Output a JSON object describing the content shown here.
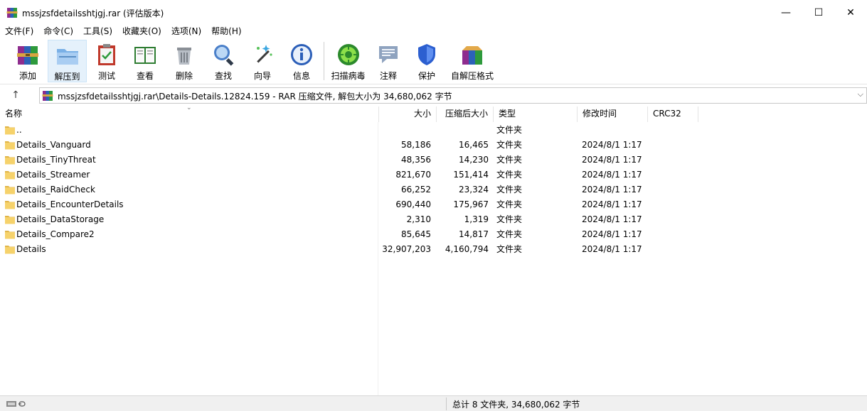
{
  "window": {
    "title": "mssjzsfdetailsshtjgj.rar (评估版本)",
    "minimize": "—",
    "maximize": "☐",
    "close": "✕"
  },
  "menu": [
    "文件(F)",
    "命令(C)",
    "工具(S)",
    "收藏夹(O)",
    "选项(N)",
    "帮助(H)"
  ],
  "toolbar": {
    "add": "添加",
    "extract": "解压到",
    "test": "测试",
    "view": "查看",
    "delete": "删除",
    "find": "查找",
    "wizard": "向导",
    "info": "信息",
    "scan": "扫描病毒",
    "comment": "注释",
    "protect": "保护",
    "sfx": "自解压格式"
  },
  "address": {
    "up": "↑",
    "path": "mssjzsfdetailsshtjgj.rar\\Details-Details.12824.159 - RAR 压缩文件, 解包大小为 34,680,062 字节",
    "dropdown": "⌵"
  },
  "columns": {
    "name": "名称",
    "size": "大小",
    "packed": "压缩后大小",
    "type": "类型",
    "modified": "修改时间",
    "crc": "CRC32",
    "sort_indicator": "⌄"
  },
  "rows": [
    {
      "name": "..",
      "size": "",
      "packed": "",
      "type": "文件夹",
      "modified": ""
    },
    {
      "name": "Details_Vanguard",
      "size": "58,186",
      "packed": "16,465",
      "type": "文件夹",
      "modified": "2024/8/1 1:17"
    },
    {
      "name": "Details_TinyThreat",
      "size": "48,356",
      "packed": "14,230",
      "type": "文件夹",
      "modified": "2024/8/1 1:17"
    },
    {
      "name": "Details_Streamer",
      "size": "821,670",
      "packed": "151,414",
      "type": "文件夹",
      "modified": "2024/8/1 1:17"
    },
    {
      "name": "Details_RaidCheck",
      "size": "66,252",
      "packed": "23,324",
      "type": "文件夹",
      "modified": "2024/8/1 1:17"
    },
    {
      "name": "Details_EncounterDetails",
      "size": "690,440",
      "packed": "175,967",
      "type": "文件夹",
      "modified": "2024/8/1 1:17"
    },
    {
      "name": "Details_DataStorage",
      "size": "2,310",
      "packed": "1,319",
      "type": "文件夹",
      "modified": "2024/8/1 1:17"
    },
    {
      "name": "Details_Compare2",
      "size": "85,645",
      "packed": "14,817",
      "type": "文件夹",
      "modified": "2024/8/1 1:17"
    },
    {
      "name": "Details",
      "size": "32,907,203",
      "packed": "4,160,794",
      "type": "文件夹",
      "modified": "2024/8/1 1:17"
    }
  ],
  "status": {
    "summary": "总计 8 文件夹, 34,680,062 字节"
  },
  "colors": {
    "folder": "#f6d26b",
    "folder_dark": "#e0b448",
    "active_tool_bg": "#e5f1fb"
  }
}
